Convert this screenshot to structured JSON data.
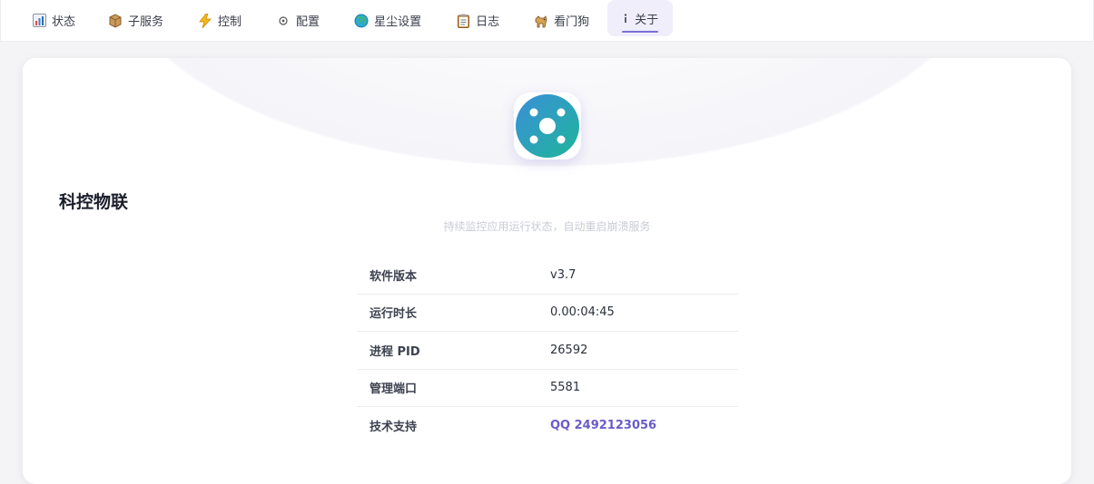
{
  "tabs": [
    {
      "label": "状态",
      "icon": "bar-chart-icon"
    },
    {
      "label": "子服务",
      "icon": "package-icon"
    },
    {
      "label": "控制",
      "icon": "lightning-icon"
    },
    {
      "label": "配置",
      "icon": "gear-icon"
    },
    {
      "label": "星尘设置",
      "icon": "globe-icon"
    },
    {
      "label": "日志",
      "icon": "clipboard-icon"
    },
    {
      "label": "看门狗",
      "icon": "dog-icon"
    },
    {
      "label": "关于",
      "icon": "info-icon",
      "active": true
    }
  ],
  "about": {
    "app_name": "科控物联",
    "tagline": "持续监控应用运行状态，自动重启崩溃服务",
    "rows": [
      {
        "key": "软件版本",
        "value": "v3.7"
      },
      {
        "key": "运行时长",
        "value": "0.00:04:45"
      },
      {
        "key": "进程 PID",
        "value": "26592"
      },
      {
        "key": "管理端口",
        "value": "5581"
      },
      {
        "key": "技术支持",
        "value": "QQ 2492123056",
        "link": true
      }
    ]
  },
  "colors": {
    "accent": "#6a5bc9",
    "logo_gradient_start": "#3a8fd9",
    "logo_gradient_end": "#1fb59a"
  }
}
